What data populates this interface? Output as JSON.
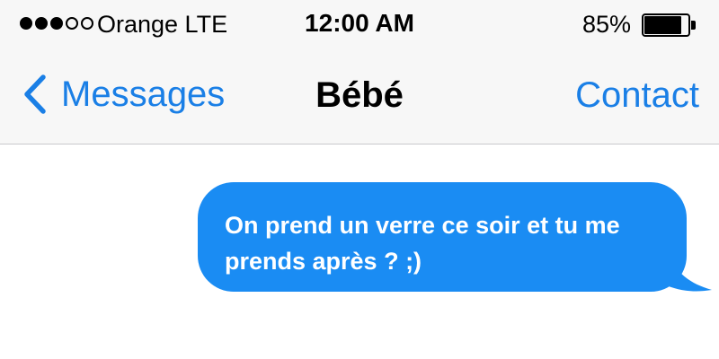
{
  "status_bar": {
    "signal_bars_filled": 3,
    "signal_bars_total": 5,
    "carrier": "Orange LTE",
    "time": "12:00 AM",
    "battery_percent": "85%",
    "battery_level": 0.85
  },
  "nav_bar": {
    "back_icon": "chevron-left-icon",
    "back_label": "Messages",
    "title": "Bébé",
    "right_button_label": "Contact"
  },
  "messages": [
    {
      "direction": "outgoing",
      "text": "On prend un verre ce soir et tu me prends après ? ;)"
    }
  ],
  "colors": {
    "accent": "#1a7fe6",
    "bubble_outgoing": "#1a8cf3",
    "chrome_background": "#f7f7f7",
    "separator": "#c8c8cc"
  }
}
